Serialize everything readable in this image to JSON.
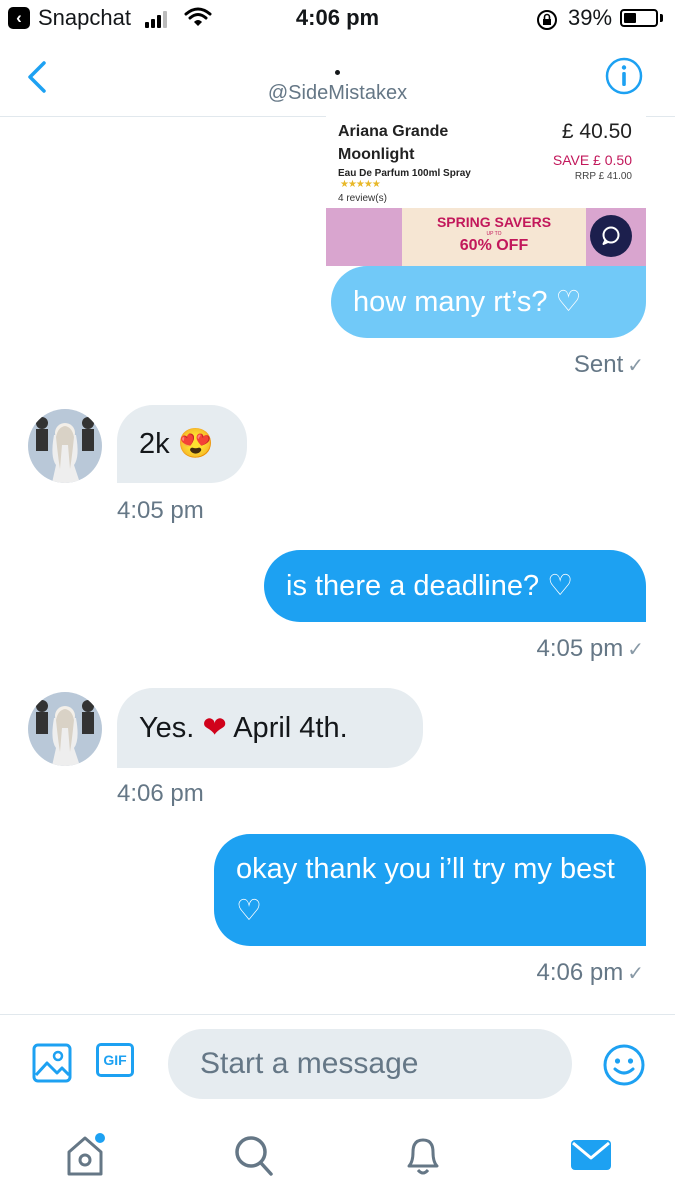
{
  "status_bar": {
    "app_name": "Snapchat",
    "time": "4:06 pm",
    "battery": "39%",
    "battery_level": 0.39
  },
  "header": {
    "handle": "@SideMistakex"
  },
  "shared_card": {
    "product_name": "Ariana Grande Moonlight",
    "description": "Eau De Parfum 100ml Spray",
    "stars": "★★★★★",
    "reviews": "4   review(s)",
    "price": "£ 40.50",
    "save": "SAVE £ 0.50",
    "rrp": "RRP £ 41.00",
    "banner_title": "SPRING SAVERS",
    "banner_upto": "UP TO",
    "banner_offer": "60% OFF"
  },
  "messages": [
    {
      "side": "sent",
      "text": "how many rt’s? ♡",
      "meta": "Sent"
    },
    {
      "side": "received",
      "text": "2k 😍",
      "meta": "4:05 pm"
    },
    {
      "side": "sent",
      "text": "is there a deadline? ♡",
      "meta": "4:05 pm"
    },
    {
      "side": "received",
      "text_before": "Yes.",
      "heart": "❤",
      "text_after": "April 4th.",
      "meta": "4:06 pm"
    },
    {
      "side": "sent",
      "text": "okay thank you i’ll try my best ♡",
      "meta": "4:06 pm"
    }
  ],
  "compose": {
    "placeholder": "Start a message",
    "gif_label": "GIF"
  },
  "colors": {
    "accent": "#1da1f2",
    "accent_light": "#71c9f8",
    "received_bubble": "#e6ecf0",
    "muted": "#657786"
  }
}
